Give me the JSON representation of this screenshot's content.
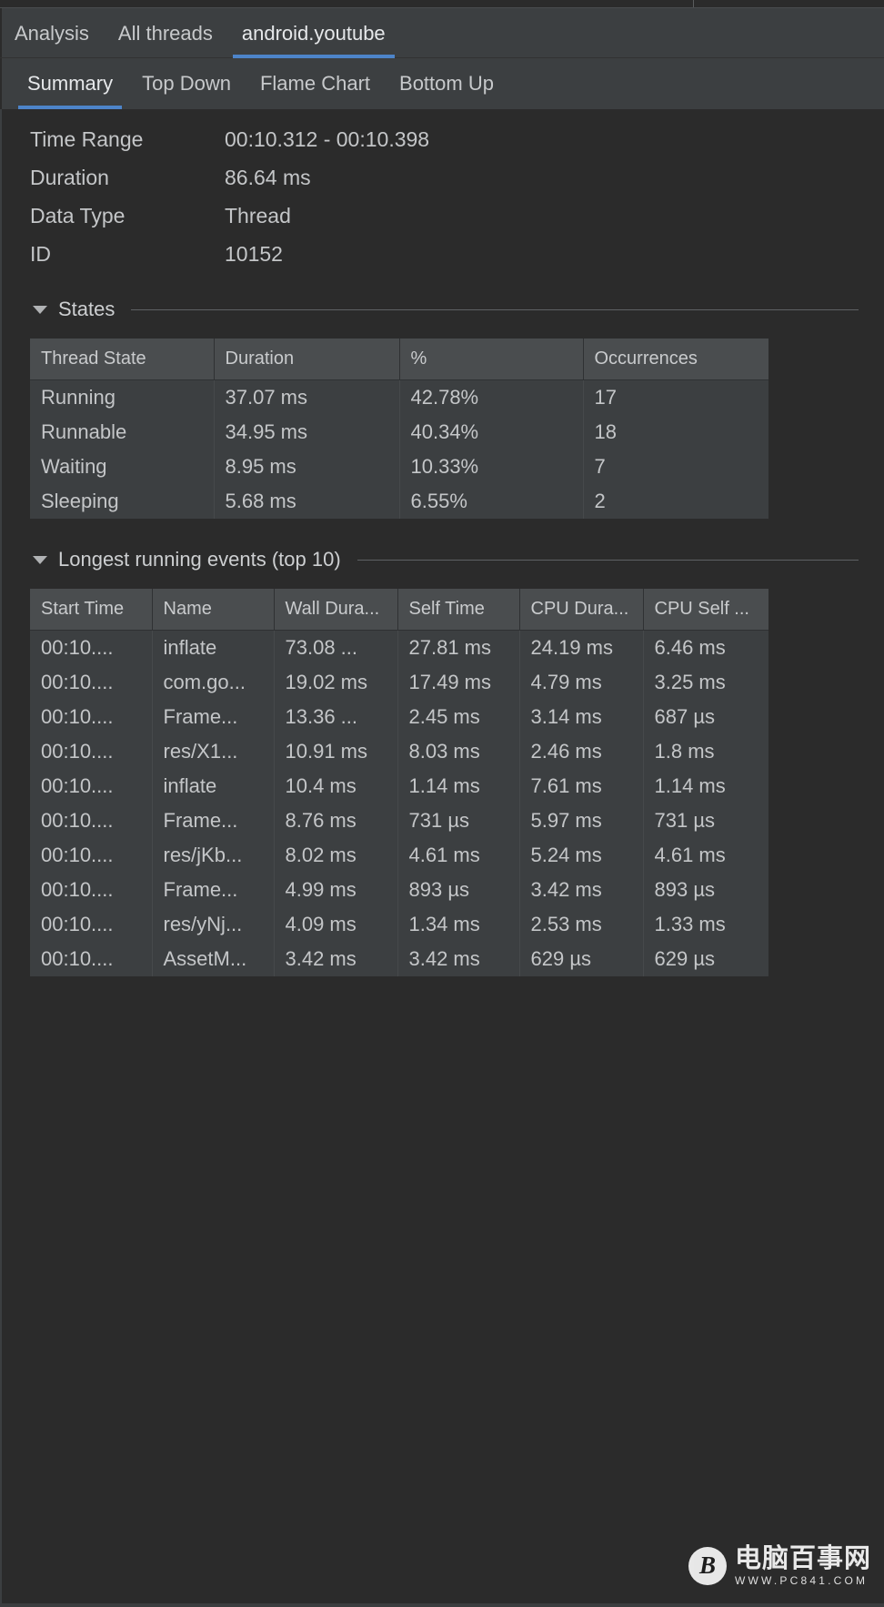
{
  "window": {
    "top_tabs": [
      {
        "label": "Analysis",
        "active": false
      },
      {
        "label": "All threads",
        "active": false
      },
      {
        "label": "android.youtube",
        "active": true
      }
    ],
    "sub_tabs": [
      {
        "label": "Summary",
        "active": true
      },
      {
        "label": "Top Down",
        "active": false
      },
      {
        "label": "Flame Chart",
        "active": false
      },
      {
        "label": "Bottom Up",
        "active": false
      }
    ],
    "accent_color": "#4d84c9"
  },
  "summary": {
    "rows": [
      {
        "key": "Time Range",
        "value": "00:10.312 - 00:10.398"
      },
      {
        "key": "Duration",
        "value": "86.64 ms"
      },
      {
        "key": "Data Type",
        "value": "Thread"
      },
      {
        "key": "ID",
        "value": "10152"
      }
    ]
  },
  "states_section": {
    "title": "States",
    "columns": [
      "Thread State",
      "Duration",
      "%",
      "Occurrences"
    ],
    "rows": [
      [
        "Running",
        "37.07 ms",
        "42.78%",
        "17"
      ],
      [
        "Runnable",
        "34.95 ms",
        "40.34%",
        "18"
      ],
      [
        "Waiting",
        "8.95 ms",
        "10.33%",
        "7"
      ],
      [
        "Sleeping",
        "5.68 ms",
        "6.55%",
        "2"
      ]
    ]
  },
  "events_section": {
    "title": "Longest running events (top 10)",
    "columns": [
      "Start Time",
      "Name",
      "Wall Dura...",
      "Self Time",
      "CPU Dura...",
      "CPU Self ..."
    ],
    "rows": [
      [
        "00:10....",
        "inflate",
        "73.08 ...",
        "27.81 ms",
        "24.19 ms",
        "6.46 ms"
      ],
      [
        "00:10....",
        "com.go...",
        "19.02 ms",
        "17.49 ms",
        "4.79 ms",
        "3.25 ms"
      ],
      [
        "00:10....",
        "Frame...",
        "13.36 ...",
        "2.45 ms",
        "3.14 ms",
        "687 µs"
      ],
      [
        "00:10....",
        "res/X1...",
        "10.91 ms",
        "8.03 ms",
        "2.46 ms",
        "1.8 ms"
      ],
      [
        "00:10....",
        "inflate",
        "10.4 ms",
        "1.14 ms",
        "7.61 ms",
        "1.14 ms"
      ],
      [
        "00:10....",
        "Frame...",
        "8.76 ms",
        "731 µs",
        "5.97 ms",
        "731 µs"
      ],
      [
        "00:10....",
        "res/jKb...",
        "8.02 ms",
        "4.61 ms",
        "5.24 ms",
        "4.61 ms"
      ],
      [
        "00:10....",
        "Frame...",
        "4.99 ms",
        "893 µs",
        "3.42 ms",
        "893 µs"
      ],
      [
        "00:10....",
        "res/yNj...",
        "4.09 ms",
        "1.34 ms",
        "2.53 ms",
        "1.33 ms"
      ],
      [
        "00:10....",
        "AssetM...",
        "3.42 ms",
        "3.42 ms",
        "629 µs",
        "629 µs"
      ]
    ]
  },
  "watermark": {
    "badge": "B",
    "name": "电脑百事网",
    "url": "WWW.PC841.COM"
  }
}
